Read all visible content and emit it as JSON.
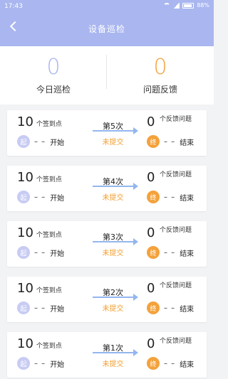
{
  "statusbar": {
    "time": "17:43",
    "battery": "88%"
  },
  "header": {
    "title": "设备巡检"
  },
  "summary": {
    "today": {
      "value": "0",
      "label": "今日巡检",
      "color": "#a9b6ef"
    },
    "feedback": {
      "value": "0",
      "label": "问题反馈",
      "color": "#f3a23c"
    }
  },
  "cards": [
    {
      "count": "10",
      "count_label": "个签到点",
      "start_badge": "起",
      "start_dash": "– –",
      "start_word": "开始",
      "round": "第5次",
      "state": "未提交",
      "fb_count": "0",
      "fb_label": "个反馈问题",
      "end_badge": "终",
      "end_dash": "– –",
      "end_word": "结束"
    },
    {
      "count": "10",
      "count_label": "个签到点",
      "start_badge": "起",
      "start_dash": "– –",
      "start_word": "开始",
      "round": "第4次",
      "state": "未提交",
      "fb_count": "0",
      "fb_label": "个反馈问题",
      "end_badge": "终",
      "end_dash": "– –",
      "end_word": "结束"
    },
    {
      "count": "10",
      "count_label": "个签到点",
      "start_badge": "起",
      "start_dash": "– –",
      "start_word": "开始",
      "round": "第3次",
      "state": "未提交",
      "fb_count": "0",
      "fb_label": "个反馈问题",
      "end_badge": "终",
      "end_dash": "– –",
      "end_word": "结束"
    },
    {
      "count": "10",
      "count_label": "个签到点",
      "start_badge": "起",
      "start_dash": "– –",
      "start_word": "开始",
      "round": "第2次",
      "state": "未提交",
      "fb_count": "0",
      "fb_label": "个反馈问题",
      "end_badge": "终",
      "end_dash": "– –",
      "end_word": "结束"
    },
    {
      "count": "10",
      "count_label": "个签到点",
      "start_badge": "起",
      "start_dash": "– –",
      "start_word": "开始",
      "round": "第1次",
      "state": "未提交",
      "fb_count": "0",
      "fb_label": "个反馈问题",
      "end_badge": "终",
      "end_dash": "– –",
      "end_word": "结束"
    }
  ]
}
